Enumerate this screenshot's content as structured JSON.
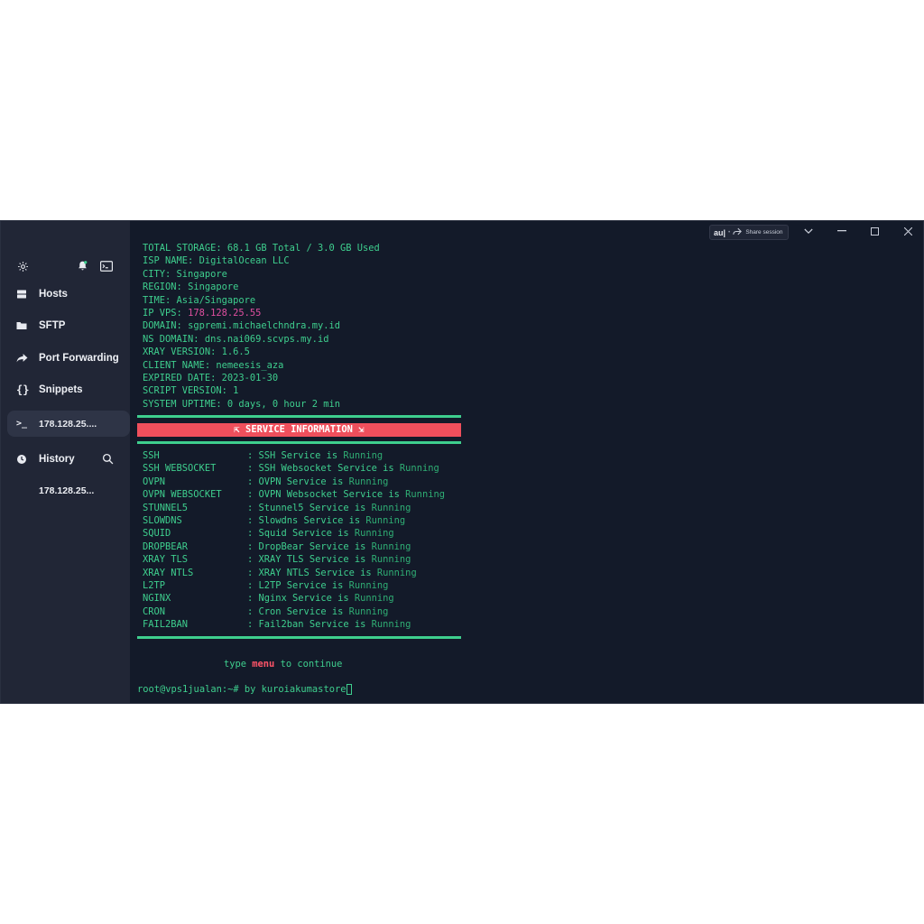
{
  "sidebar": {
    "items": [
      {
        "label": "Hosts",
        "icon": "hosts-icon"
      },
      {
        "label": "SFTP",
        "icon": "folder-icon"
      },
      {
        "label": "Port Forwarding",
        "icon": "forward-icon"
      },
      {
        "label": "Snippets",
        "icon": "braces-icon"
      },
      {
        "label": "178.128.25....",
        "icon": "terminal-icon"
      },
      {
        "label": "History",
        "icon": "clock-icon"
      },
      {
        "label": "178.128.25...",
        "icon": "none"
      }
    ]
  },
  "topbar": {
    "share_prefix": "au|",
    "share_label": "Share session"
  },
  "terminal": {
    "info": [
      {
        "key": "TOTAL STORAGE:",
        "value": "68.1 GB Total / 3.0 GB Used"
      },
      {
        "key": "ISP NAME:",
        "value": "DigitalOcean LLC"
      },
      {
        "key": "CITY:",
        "value": "Singapore"
      },
      {
        "key": "REGION:",
        "value": "Singapore"
      },
      {
        "key": "TIME:",
        "value": "Asia/Singapore"
      },
      {
        "key": "IP VPS:",
        "value": "178.128.25.55"
      },
      {
        "key": "DOMAIN:",
        "value": "sgpremi.michaelchndra.my.id"
      },
      {
        "key": "NS DOMAIN:",
        "value": "dns.nai069.scvps.my.id"
      },
      {
        "key": "XRAY VERSION:",
        "value": "1.6.5"
      },
      {
        "key": "CLIENT NAME:",
        "value": "nemeesis_aza"
      },
      {
        "key": "EXPIRED DATE:",
        "value": "2023-01-30"
      },
      {
        "key": "SCRIPT VERSION:",
        "value": "1"
      },
      {
        "key": "SYSTEM UPTIME:",
        "value": "0 days, 0 hour 2 min"
      }
    ],
    "banner": "⇱ SERVICE INFORMATION ⇲",
    "services": [
      {
        "name": "SSH",
        "desc": ": SSH Service is",
        "status": "Running"
      },
      {
        "name": "SSH WEBSOCKET",
        "desc": ": SSH Websocket Service is",
        "status": "Running"
      },
      {
        "name": "OVPN",
        "desc": ": OVPN Service is",
        "status": "Running"
      },
      {
        "name": "OVPN WEBSOCKET",
        "desc": ": OVPN Websocket Service is",
        "status": "Running"
      },
      {
        "name": "STUNNEL5",
        "desc": ": Stunnel5 Service is",
        "status": "Running"
      },
      {
        "name": "SLOWDNS",
        "desc": ": Slowdns Service is",
        "status": "Running"
      },
      {
        "name": "SQUID",
        "desc": ": Squid Service is",
        "status": "Running"
      },
      {
        "name": "DROPBEAR",
        "desc": ": DropBear Service is",
        "status": "Running"
      },
      {
        "name": "XRAY TLS",
        "desc": ": XRAY TLS Service is",
        "status": "Running"
      },
      {
        "name": "XRAY NTLS",
        "desc": ": XRAY NTLS Service is",
        "status": "Running"
      },
      {
        "name": "L2TP",
        "desc": ": L2TP Service is",
        "status": "Running"
      },
      {
        "name": "NGINX",
        "desc": ": Nginx Service is",
        "status": "Running"
      },
      {
        "name": "CRON",
        "desc": ": Cron Service is",
        "status": "Running"
      },
      {
        "name": "FAIL2BAN",
        "desc": ": Fail2ban Service is",
        "status": "Running"
      }
    ],
    "continue_pre": "type ",
    "continue_cmd": "menu",
    "continue_post": " to continue",
    "prompt": "root@vps1jualan:~# by kuroiakumastore"
  },
  "colors": {
    "terminal_bg": "#131a29",
    "sidebar_bg": "#212636",
    "green": "#3ecf8e",
    "banner_red": "#ef4f5c",
    "ip_pink": "#e04fa0"
  }
}
